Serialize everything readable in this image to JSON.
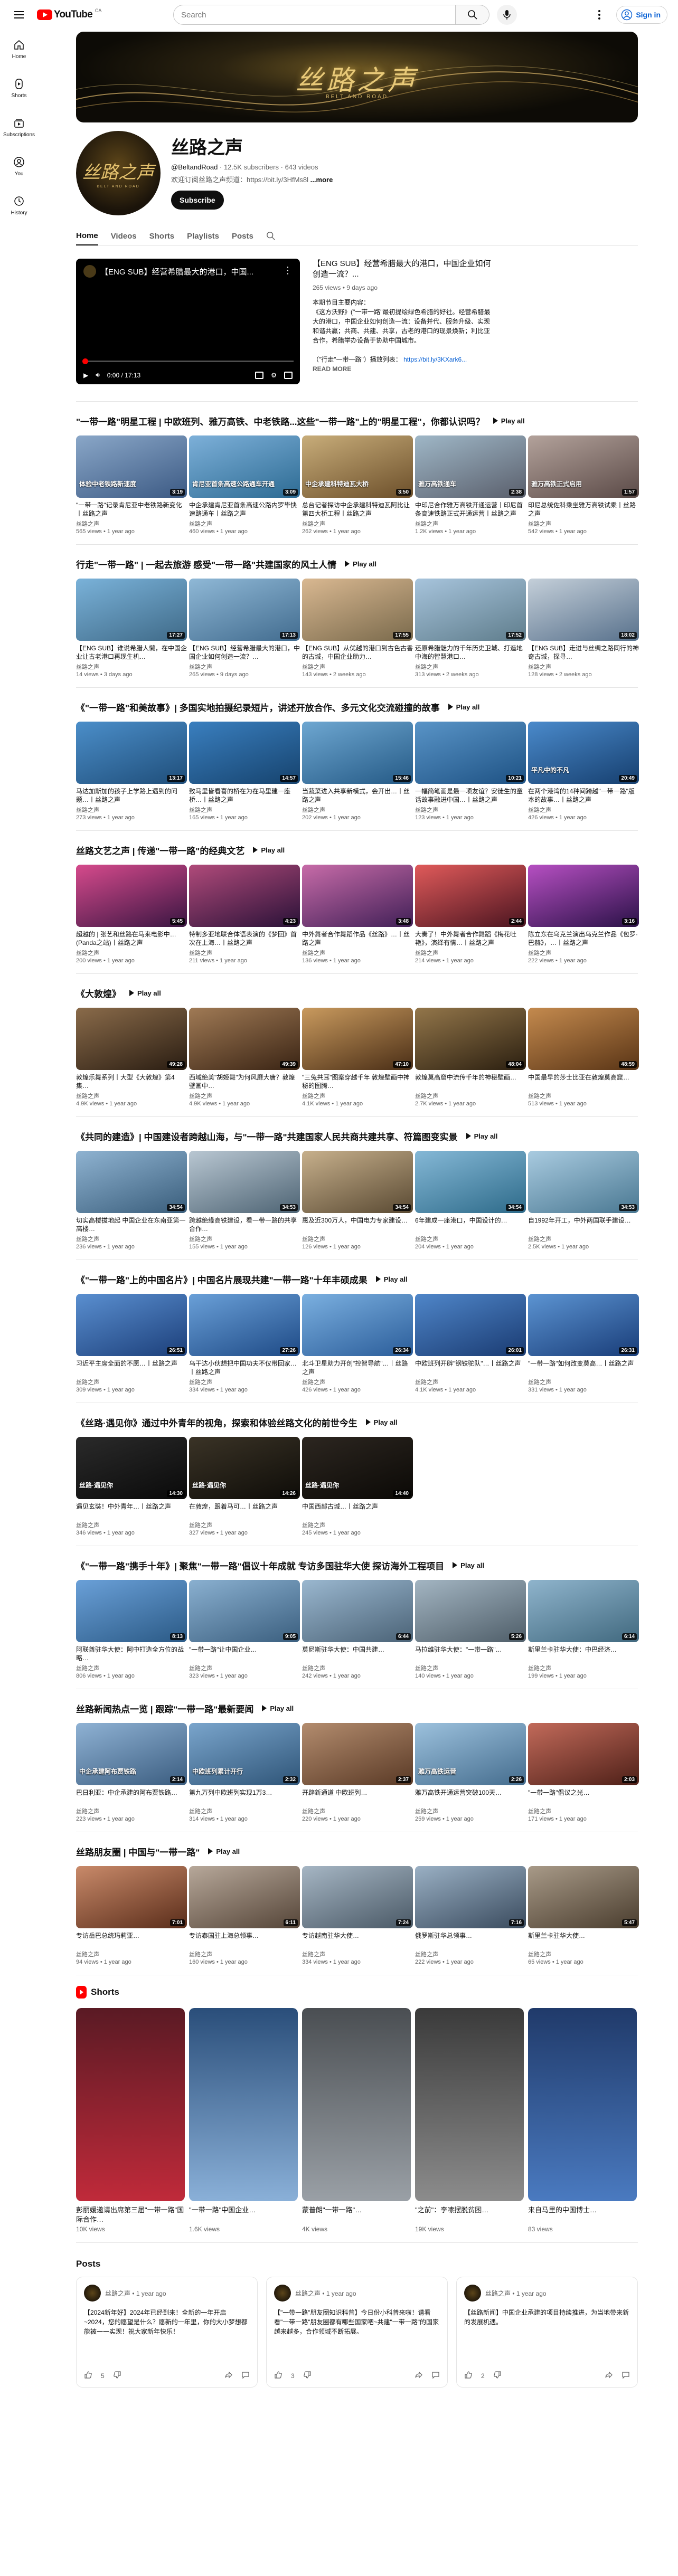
{
  "header": {
    "logo_text": "YouTube",
    "logo_country": "CA",
    "search_placeholder": "Search",
    "sign_in_label": "Sign in"
  },
  "sidebar": {
    "items": [
      {
        "label": "Home",
        "icon": "home-icon"
      },
      {
        "label": "Shorts",
        "icon": "shorts-icon"
      },
      {
        "label": "Subscriptions",
        "icon": "subscriptions-icon"
      },
      {
        "label": "You",
        "icon": "you-icon"
      },
      {
        "label": "History",
        "icon": "history-icon"
      }
    ]
  },
  "banner": {
    "title": "丝路之声",
    "subtitle": "BELT AND ROAD"
  },
  "channel": {
    "avatar_text": "丝路之声",
    "avatar_sub": "BELT AND ROAD",
    "name": "丝路之声",
    "handle": "@BeltandRoad",
    "subscribers": "12.5K subscribers",
    "videos": "643 videos",
    "description": "欢迎订阅丝路之声频道：https://bit.ly/3HfMs8l",
    "more_label": "...more",
    "subscribe_label": "Subscribe"
  },
  "tabs": [
    {
      "label": "Home",
      "active": true
    },
    {
      "label": "Videos",
      "active": false
    },
    {
      "label": "Shorts",
      "active": false
    },
    {
      "label": "Playlists",
      "active": false
    },
    {
      "label": "Posts",
      "active": false
    }
  ],
  "featured": {
    "player_title": "【ENG SUB】经营希腊最大的港口，中国...",
    "time": "0:00 / 17:13",
    "title": "【ENG SUB】经营希腊最大的港口，中国企业如何创造一流？...",
    "meta": "265 views • 9 days ago",
    "description": "本期节目主要内容：\n《这方沃野》(\"一带一路\"最初提绘绿色希腊的好社。经营希腊最大的港口，中国企业如何创造一流：设备并代、服务升级、实现和谐共赢；共商、共建、共享，古老的港口的现景焕新；利比亚合作，希腊举办设备于协助中国城市。\n\n（\"行走\"一带一路\"）播放列表：",
    "link": "https://bit.ly/3KXark6...",
    "read_more": "READ MORE"
  },
  "shelves": [
    {
      "title": "\"一带一路\"明星工程 | 中欧班列、雅万高铁、中老铁路...这些\"一带一路\"上的\"明星工程\"，你都认识吗？",
      "play_all": "Play all",
      "videos": [
        {
          "title": "\"一带一路\"记录肯尼亚中老铁路新变化丨丝路之声",
          "channel": "丝路之声",
          "meta": "565 views • 1 year ago",
          "dur": "3:19",
          "cap": "体验中老铁路新速度",
          "c1": "#8aa7c8",
          "c2": "#3c5a84"
        },
        {
          "title": "中企承建肯尼亚首条高速公路内罗毕快速路通车丨丝路之声",
          "channel": "丝路之声",
          "meta": "460 views • 1 year ago",
          "dur": "3:09",
          "cap": "肯尼亚首条高速公路通车开通",
          "c1": "#7db0d9",
          "c2": "#2d6b93"
        },
        {
          "title": "总台记者探访中企承建科特迪瓦阿比让第四大桥工程丨丝路之声",
          "channel": "丝路之声",
          "meta": "262 views • 1 year ago",
          "dur": "3:50",
          "cap": "中企承建科特迪瓦大桥",
          "c1": "#c8ad7a",
          "c2": "#6c4f2a"
        },
        {
          "title": "中印尼合作雅万高铁开通运营丨印尼首条高速铁路正式开通运营丨丝路之声",
          "channel": "丝路之声",
          "meta": "1.2K views • 1 year ago",
          "dur": "2:38",
          "cap": "雅万高铁通车",
          "c1": "#9fb7c7",
          "c2": "#5a5f6c"
        },
        {
          "title": "印尼总统佐科乘坐雅万高铁试乘丨丝路之声",
          "channel": "丝路之声",
          "meta": "542 views • 1 year ago",
          "dur": "1:57",
          "cap": "雅万高铁正式启用",
          "c1": "#b3a29b",
          "c2": "#5b4a47"
        }
      ]
    },
    {
      "title": "行走\"一带一路\" | 一起去旅游 感受\"一带一路\"共建国家的风土人情",
      "play_all": "Play all",
      "videos": [
        {
          "title": "【ENG SUB】谁说希腊人懒，在中国企业让古老港口再现生机…",
          "channel": "丝路之声",
          "meta": "14 views • 3 days ago",
          "dur": "17:27",
          "cap": "",
          "c1": "#7ab2d9",
          "c2": "#3f6a88"
        },
        {
          "title": "【ENG SUB】经营希腊最大的港口，中国企业如何创造一流？…",
          "channel": "丝路之声",
          "meta": "265 views • 9 days ago",
          "dur": "17:13",
          "cap": "",
          "c1": "#8fb8d6",
          "c2": "#426c8f"
        },
        {
          "title": "【ENG SUB】从优越的港口到古色古香的古城，中国企业助力…",
          "channel": "丝路之声",
          "meta": "143 views • 2 weeks ago",
          "dur": "17:55",
          "cap": "",
          "c1": "#d9b891",
          "c2": "#7a6a4c"
        },
        {
          "title": "还原希腊魅力的千年历史卫城、打造地中海的智慧港口…",
          "channel": "丝路之声",
          "meta": "313 views • 2 weeks ago",
          "dur": "17:52",
          "cap": "",
          "c1": "#a7c4dc",
          "c2": "#5f7d8c"
        },
        {
          "title": "【ENG SUB】走进与丝绸之路同行的神奇古城，探寻…",
          "channel": "丝路之声",
          "meta": "128 views • 2 weeks ago",
          "dur": "18:02",
          "cap": "",
          "c1": "#c4cfd9",
          "c2": "#58718c"
        }
      ]
    },
    {
      "title": "《\"一带一路\"和美故事》| 多国实地拍摄纪录短片，讲述开放合作、多元文化交流碰撞的故事",
      "play_all": "Play all",
      "videos": [
        {
          "title": "马达加斯加的孩子上学路上遇到的问题…丨丝路之声",
          "channel": "丝路之声",
          "meta": "273 views • 1 year ago",
          "dur": "13:17",
          "cap": "",
          "c1": "#4b8ec9",
          "c2": "#1f4e7a"
        },
        {
          "title": "致马里皆看喜的桥在为在马里建一座桥…丨丝路之声",
          "channel": "丝路之声",
          "meta": "165 views • 1 year ago",
          "dur": "14:57",
          "cap": "",
          "c1": "#3a7fbf",
          "c2": "#16436e"
        },
        {
          "title": "当蔬菜进入共享新模式，会开出…丨丝路之声",
          "channel": "丝路之声",
          "meta": "202 views • 1 year ago",
          "dur": "15:46",
          "cap": "",
          "c1": "#6ea7d1",
          "c2": "#255a86"
        },
        {
          "title": "一幅简笔画是最一项友谊？安徒生的童话故事融进中国…丨丝路之声",
          "channel": "丝路之声",
          "meta": "123 views • 1 year ago",
          "dur": "10:21",
          "cap": "",
          "c1": "#5994c7",
          "c2": "#1e5284"
        },
        {
          "title": "在两个港湾的14种间跨越\"一带一路\"版本的故事…丨丝路之声",
          "channel": "丝路之声",
          "meta": "426 views • 1 year ago",
          "dur": "20:49",
          "cap": "平凡中的不凡",
          "c1": "#4a8acb",
          "c2": "#163f6f"
        }
      ]
    },
    {
      "title": "丝路文艺之声 | 传递\"一带一路\"的经典文艺",
      "play_all": "Play all",
      "videos": [
        {
          "title": "超越的 | 张艺和丝路在马来电影中…(Panda之站)丨丝路之声",
          "channel": "丝路之声",
          "meta": "200 views • 1 year ago",
          "dur": "5:45",
          "cap": "",
          "c1": "#d64a8c",
          "c2": "#3a1642"
        },
        {
          "title": "特制多亚地联合体语表演的《梦回》首次在上海…丨丝路之声",
          "channel": "丝路之声",
          "meta": "211 views • 1 year ago",
          "dur": "4:23",
          "cap": "",
          "c1": "#b04a7a",
          "c2": "#2a1238"
        },
        {
          "title": "中外舞者合作舞蹈作品《丝路》…丨丝路之声",
          "channel": "丝路之声",
          "meta": "136 views • 1 year ago",
          "dur": "3:48",
          "cap": "",
          "c1": "#c76ba8",
          "c2": "#412057"
        },
        {
          "title": "大奏了！中外舞者合作舞蹈《梅花吐艳》，演绎有情…丨丝路之声",
          "channel": "丝路之声",
          "meta": "214 views • 1 year ago",
          "dur": "2:44",
          "cap": "",
          "c1": "#e05a5a",
          "c2": "#4b1520"
        },
        {
          "title": "陈立东在乌克兰演出乌克兰作品《包罗·巴赫》，…丨丝路之声",
          "channel": "丝路之声",
          "meta": "222 views • 1 year ago",
          "dur": "3:16",
          "cap": "",
          "c1": "#b64fc2",
          "c2": "#2b1248"
        }
      ]
    },
    {
      "title": "《大敦煌》",
      "play_all": "Play all",
      "videos": [
        {
          "title": "敦煌乐舞系列丨大型《大敦煌》第4集…",
          "channel": "丝路之声",
          "meta": "4.9K views • 1 year ago",
          "dur": "49:28",
          "cap": "",
          "c1": "#8a6b4a",
          "c2": "#2a1d12"
        },
        {
          "title": "西域绝美\"胡姬舞\"为何风靡大唐？敦煌壁画中…",
          "channel": "丝路之声",
          "meta": "4.9K views • 1 year ago",
          "dur": "49:39",
          "cap": "",
          "c1": "#a07a55",
          "c2": "#3a2414"
        },
        {
          "title": "\"三兔共耳\"图案穿越千年 敦煌壁画中神秘的图腾…",
          "channel": "丝路之声",
          "meta": "4.1K views • 1 year ago",
          "dur": "47:10",
          "cap": "",
          "c1": "#c99a5e",
          "c2": "#4a2e16"
        },
        {
          "title": "敦煌莫高窟中流传千年的神秘壁画…",
          "channel": "丝路之声",
          "meta": "2.7K views • 1 year ago",
          "dur": "48:04",
          "cap": "",
          "c1": "#93764a",
          "c2": "#2b1f10"
        },
        {
          "title": "中国最早的莎士比亚在敦煌莫高窟…",
          "channel": "丝路之声",
          "meta": "513 views • 1 year ago",
          "dur": "48:59",
          "cap": "",
          "c1": "#c48a4e",
          "c2": "#5a3516"
        }
      ]
    },
    {
      "title": "《共同的建造》| 中国建设者跨越山海，与\"一带一路\"共建国家人民共商共建共享、符篇图变实景",
      "play_all": "Play all",
      "videos": [
        {
          "title": "切实高楼拔地起 中国企业在东南亚第一高楼…",
          "channel": "丝路之声",
          "meta": "236 views • 1 year ago",
          "dur": "34:54",
          "cap": "",
          "c1": "#8fb3d1",
          "c2": "#3a5e7c"
        },
        {
          "title": "跨越绝缘高铁建设，看一带一路的共享合作…",
          "channel": "丝路之声",
          "meta": "155 views • 1 year ago",
          "dur": "34:53",
          "cap": "",
          "c1": "#b9c7d2",
          "c2": "#4e6474"
        },
        {
          "title": "惠及近300万人，中国电力专家建设…",
          "channel": "丝路之声",
          "meta": "126 views • 1 year ago",
          "dur": "34:54",
          "cap": "",
          "c1": "#c7b08c",
          "c2": "#5a4a33"
        },
        {
          "title": "6年建成一座港口，中国设计的…",
          "channel": "丝路之声",
          "meta": "204 views • 1 year ago",
          "dur": "34:54",
          "cap": "",
          "c1": "#85b8d6",
          "c2": "#2e6b8a"
        },
        {
          "title": "自1992年开工，中外两国联手建设…",
          "channel": "丝路之声",
          "meta": "2.5K views • 1 year ago",
          "dur": "34:53",
          "cap": "",
          "c1": "#a9cbe0",
          "c2": "#4a7892"
        }
      ]
    },
    {
      "title": "《\"一带一路\"上的中国名片》| 中国名片展现共建\"一带一路\"十年丰硕成果",
      "play_all": "Play all",
      "videos": [
        {
          "title": "习近平主席全面的不愿…丨丝路之声",
          "channel": "丝路之声",
          "meta": "309 views • 1 year ago",
          "dur": "26:51",
          "cap": "",
          "c1": "#5a8fd0",
          "c2": "#1c3f7a"
        },
        {
          "title": "乌干达小伙想把中国功夫不仅带回家…丨丝路之声",
          "channel": "丝路之声",
          "meta": "334 views • 1 year ago",
          "dur": "27:26",
          "cap": "",
          "c1": "#6aa0d8",
          "c2": "#1e4a86"
        },
        {
          "title": "北斗卫星助力开创\"控智导航\"…丨丝路之声",
          "channel": "丝路之声",
          "meta": "426 views • 1 year ago",
          "dur": "26:34",
          "cap": "",
          "c1": "#7bb0e0",
          "c2": "#2b5d9a"
        },
        {
          "title": "中欧班列开辟\"钢铁驼队\"…丨丝路之声",
          "channel": "丝路之声",
          "meta": "4.1K views • 1 year ago",
          "dur": "26:01",
          "cap": "",
          "c1": "#4f86c9",
          "c2": "#1a3b72"
        },
        {
          "title": "\"一带一路\"如何改变莫高…丨丝路之声",
          "channel": "丝路之声",
          "meta": "331 views • 1 year ago",
          "dur": "26:31",
          "cap": "",
          "c1": "#5c94d2",
          "c2": "#193d79"
        }
      ]
    },
    {
      "title": "《丝路·遇见你》通过中外青年的视角，探索和体验丝路文化的前世今生",
      "play_all": "Play all",
      "videos": [
        {
          "title": "遇见玄奘！中外青年…丨丝路之声",
          "channel": "丝路之声",
          "meta": "346 views • 1 year ago",
          "dur": "14:30",
          "cap": "丝路·遇见你",
          "c1": "#2a2a2a",
          "c2": "#0a0a0a"
        },
        {
          "title": "在敦煌，跟着马可…丨丝路之声",
          "channel": "丝路之声",
          "meta": "327 views • 1 year ago",
          "dur": "14:26",
          "cap": "丝路·遇见你",
          "c1": "#3a3326",
          "c2": "#0e0c08"
        },
        {
          "title": "中国西部古城…丨丝路之声",
          "channel": "丝路之声",
          "meta": "245 views • 1 year ago",
          "dur": "14:40",
          "cap": "丝路·遇见你",
          "c1": "#2c2620",
          "c2": "#0b0906"
        }
      ]
    },
    {
      "title": "《\"一带一路\"携手十年》| 聚焦\"一带一路\"倡议十年成就 专访多国驻华大使 探访海外工程项目",
      "play_all": "Play all",
      "videos": [
        {
          "title": "阿联酋驻华大使：阿中打造全方位的战略…",
          "channel": "丝路之声",
          "meta": "806 views • 1 year ago",
          "dur": "8:13",
          "cap": "",
          "c1": "#6aa0d8",
          "c2": "#2b5a86"
        },
        {
          "title": "\"一带一路\"让中国企业…",
          "channel": "丝路之声",
          "meta": "323 views • 1 year ago",
          "dur": "9:05",
          "cap": "",
          "c1": "#8ab0d0",
          "c2": "#3b5f7f"
        },
        {
          "title": "莫尼斯驻华大使：中国共建…",
          "channel": "丝路之声",
          "meta": "242 views • 1 year ago",
          "dur": "6:44",
          "cap": "",
          "c1": "#9ab7cf",
          "c2": "#4b6377"
        },
        {
          "title": "马拉维驻华大使：\"一带一路\"…",
          "channel": "丝路之声",
          "meta": "140 views • 1 year ago",
          "dur": "5:26",
          "cap": "",
          "c1": "#a3b5c2",
          "c2": "#4f5e69"
        },
        {
          "title": "斯里兰卡驻华大使：中巴经济…",
          "channel": "丝路之声",
          "meta": "199 views • 1 year ago",
          "dur": "6:14",
          "cap": "",
          "c1": "#8fb4cc",
          "c2": "#41697f"
        }
      ]
    },
    {
      "title": "丝路新闻热点一览 | 跟踪\"一带一路\"最新要闻",
      "play_all": "Play all",
      "videos": [
        {
          "title": "巴日利亚：中企承建的阿布贾铁路…",
          "channel": "丝路之声",
          "meta": "223 views • 1 year ago",
          "dur": "2:14",
          "cap": "中企承建阿布贾铁路",
          "c1": "#8fb2d4",
          "c2": "#3b5d80"
        },
        {
          "title": "第九万列中欧班列实现1万3…",
          "channel": "丝路之声",
          "meta": "314 views • 1 year ago",
          "dur": "2:32",
          "cap": "中欧班列累计开行",
          "c1": "#7aa5cc",
          "c2": "#2f5578"
        },
        {
          "title": "开辟新通道 中欧班列…",
          "channel": "丝路之声",
          "meta": "220 views • 1 year ago",
          "dur": "2:37",
          "cap": "",
          "c1": "#b38c6e",
          "c2": "#5a3a26"
        },
        {
          "title": "雅万高铁开通运营突破100天…",
          "channel": "丝路之声",
          "meta": "259 views • 1 year ago",
          "dur": "2:26",
          "cap": "雅万高铁运营",
          "c1": "#9cc1dd",
          "c2": "#456d8e"
        },
        {
          "title": "\"一带一路\"倡议之光…",
          "channel": "丝路之声",
          "meta": "171 views • 1 year ago",
          "dur": "2:03",
          "cap": "",
          "c1": "#c26a5a",
          "c2": "#4e2018"
        }
      ]
    },
    {
      "title": "丝路朋友圈 | 中国与\"一带一路\"",
      "play_all": "Play all",
      "videos": [
        {
          "title": "专访岳巴总统玛莉亚…",
          "channel": "丝路之声",
          "meta": "94 views • 1 year ago",
          "dur": "7:01",
          "cap": "",
          "c1": "#c98a6a",
          "c2": "#5a2d1a"
        },
        {
          "title": "专访泰国驻上海总领事…",
          "channel": "丝路之声",
          "meta": "160 views • 1 year ago",
          "dur": "6:11",
          "cap": "",
          "c1": "#b7a89a",
          "c2": "#554538"
        },
        {
          "title": "专访越南驻华大使…",
          "channel": "丝路之声",
          "meta": "334 views • 1 year ago",
          "dur": "7:24",
          "cap": "",
          "c1": "#a6b6c4",
          "c2": "#4a5966"
        },
        {
          "title": "俄罗斯驻华总领事…",
          "channel": "丝路之声",
          "meta": "222 views • 1 year ago",
          "dur": "7:16",
          "cap": "",
          "c1": "#9ab0c4",
          "c2": "#3a4b5e"
        },
        {
          "title": "斯里兰卡驻华大使…",
          "channel": "丝路之声",
          "meta": "65 views • 1 year ago",
          "dur": "5:47",
          "cap": "",
          "c1": "#a89a88",
          "c2": "#4a3d2e"
        }
      ]
    }
  ],
  "shorts": {
    "title": "Shorts",
    "items": [
      {
        "title": "彭丽媛邀请出席第三届\"一带一路\"国际合作…",
        "views": "10K views",
        "c1": "#5a1a24",
        "c2": "#c02a3a"
      },
      {
        "title": "\"一带一路\"中国企业…",
        "views": "1.6K views",
        "c1": "#2a4e7a",
        "c2": "#8ab0d8"
      },
      {
        "title": "蒙普朗\"一带一路\"…",
        "views": "4K views",
        "c1": "#4a4e52",
        "c2": "#9aa0a6"
      },
      {
        "title": "\"之前\"：李嗦摆脱贫困…",
        "views": "19K views",
        "c1": "#3a3a3a",
        "c2": "#8c8c8c"
      },
      {
        "title": "来自马里的中国博士…",
        "views": "83 views",
        "c1": "#203a6a",
        "c2": "#4a7ac0"
      }
    ]
  },
  "posts": {
    "title": "Posts",
    "items": [
      {
        "channel": "丝路之声 • 1 year ago",
        "body": "【2024新年好】2024年已经到来！全新的一年开启~2024，您的愿望是什么？愿新的一年里，你的大小梦想都能被一一实现！祝大家新年快乐！",
        "likes": "5"
      },
      {
        "channel": "丝路之声 • 1 year ago",
        "body": "【\"一带一路\"朋友圈知识科普】今日份小科普来啦！请看看\"一带一路\"朋友圈都有哪些国家吧~共建\"一带一路\"的国家越来越多，合作领域不断拓展。",
        "likes": "3"
      },
      {
        "channel": "丝路之声 • 1 year ago",
        "body": "【丝路新闻】中国企业承建的项目持续推进，为当地带来新的发展机遇。",
        "likes": "2"
      }
    ]
  }
}
